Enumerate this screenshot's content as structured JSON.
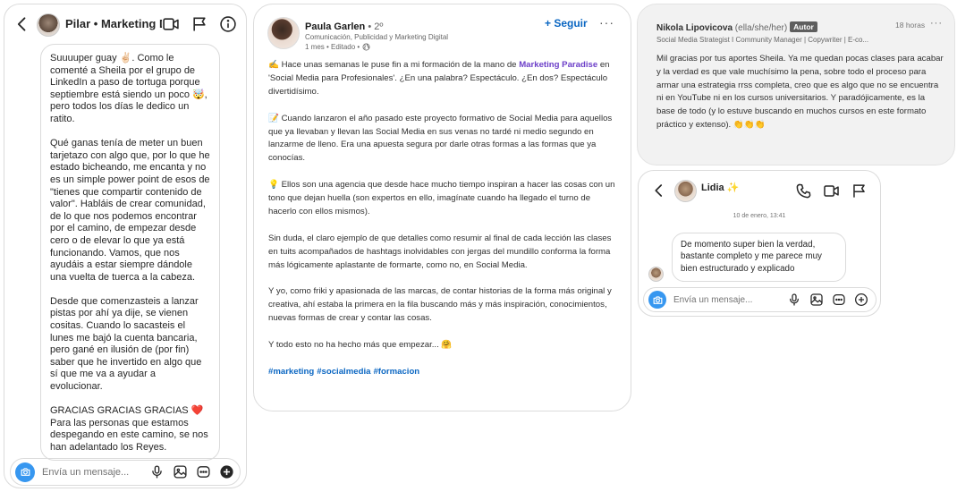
{
  "ig_left": {
    "contact_name": "Pilar • Marketing D...",
    "message": [
      "Suuuuper guay ✌🏻. Como le comenté a Sheila por el grupo de LinkedIn a paso de tortuga porque septiembre está siendo un poco 🤯, pero todos los días le dedico un ratito.",
      "Qué ganas tenía de meter un buen tarjetazo con algo que, por lo que he estado bicheando, me encanta y no es un simple power point de esos de \"tienes que compartir contenido de valor\". Habláis de crear comunidad, de lo que nos podemos encontrar por el camino, de empezar desde cero o de elevar lo que ya está funcionando. Vamos, que nos ayudáis a estar siempre dándole una vuelta de tuerca a la cabeza.",
      "Desde que comenzasteis a lanzar pistas por ahí ya dije, se vienen cositas. Cuando lo sacasteis el lunes me bajó la cuenta bancaria,  pero gané en ilusión de (por fin) saber que he invertido en algo que sí que me va a ayudar a evolucionar.",
      "GRACIAS GRACIAS GRACIAS ❤️\nPara las personas que estamos despegando en este camino, se nos han adelantado los Reyes."
    ],
    "composer_placeholder": "Envía un mensaje..."
  },
  "li_post": {
    "author_name": "Paula Garlen",
    "degree": " • 2º",
    "headline": "Comunicación, Publicidad y Marketing Digital",
    "meta": "1 mes • Editado •",
    "follow_label": "+ Seguir",
    "more": "···",
    "p1_before": "✍️ Hace unas semanas le puse fin a mi formación de la mano de ",
    "p1_link": "Marketing Paradise",
    "p1_after": " en 'Social Media para Profesionales'. ¿En una palabra? Espectáculo. ¿En dos? Espectáculo divertidísimo.",
    "p2": "📝 Cuando lanzaron el año pasado este proyecto formativo de Social Media para aquellos que ya llevaban y llevan las Social Media en sus venas no tardé ni medio segundo en lanzarme de lleno. Era una apuesta segura por darle otras formas a las formas que ya conocías.",
    "p3": "💡 Ellos son una agencia que desde hace mucho tiempo inspiran a hacer las cosas con un tono que dejan huella (son expertos en ello, imagínate cuando ha llegado el turno de hacerlo con ellos mismos).",
    "p4": "Sin duda, el claro ejemplo de que detalles como resumir al final de cada lección las clases en tuits acompañados de hashtags inolvidables con jergas del mundillo conforma la forma más lógicamente aplastante de formarte, como no, en Social Media.",
    "p5": "Y yo, como friki y apasionada de las marcas, de contar historias de la forma más original y creativa, ahí estaba la primera en la fila buscando más y más inspiración, conocimientos, nuevas formas de crear y contar las cosas.",
    "p6": "Y todo esto no ha hecho más que empezar... 🤗",
    "hashtags": [
      "#marketing",
      "#socialmedia",
      "#formacion"
    ]
  },
  "li_comment": {
    "author_name": "Nikola Lipovicova",
    "pronouns": " (ella/she/her)",
    "badge": "Autor",
    "time": "18 horas",
    "more": "···",
    "headline": "Social Media Strategist I Community Manager | Copywriter | E-co...",
    "body": "Mil gracias por tus aportes Sheila. Ya me quedan pocas clases para acabar y la verdad es que vale muchísimo la pena, sobre todo el proceso para armar una estrategia rrss completa, creo que es algo que no se encuentra ni en YouTube ni en los cursos universitarios. Y paradójicamente, es la base de todo (y lo estuve buscando en muchos cursos en este formato práctico y extenso). 👏👏👏"
  },
  "ig_right": {
    "contact_name": "Lidia",
    "sparkle": " ✨",
    "date": "10 de enero, 13:41",
    "message": "De momento super bien la verdad, bastante completo y me parece muy bien estructurado y explicado",
    "composer_placeholder": "Envía un mensaje..."
  },
  "colors": {
    "linkedin_blue": "#0a66c2",
    "link_purple": "#6c3fc8",
    "instagram_blue": "#3797f0",
    "comment_bg": "#f2f2f2"
  }
}
